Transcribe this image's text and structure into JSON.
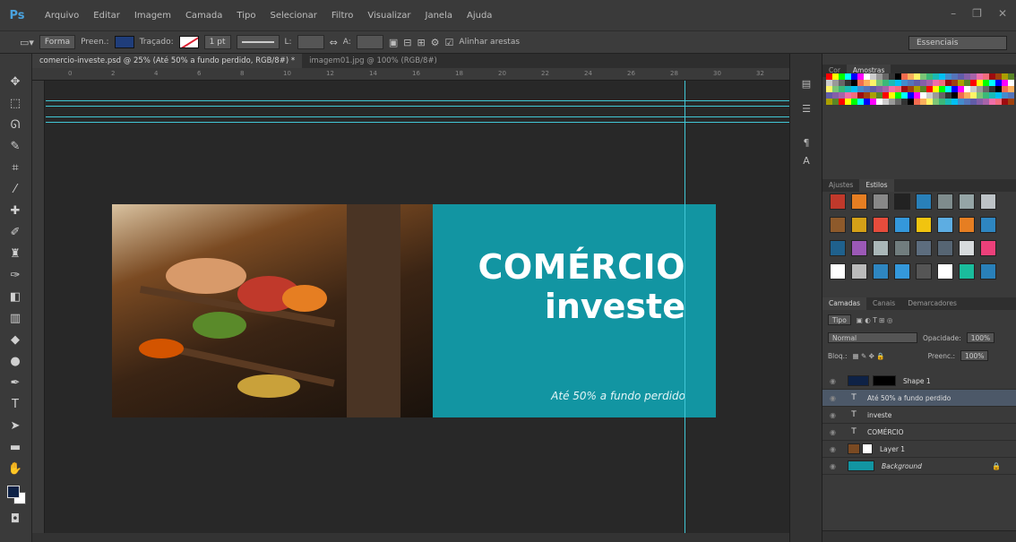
{
  "app": {
    "logo": "Ps"
  },
  "menu": [
    "Arquivo",
    "Editar",
    "Imagem",
    "Camada",
    "Tipo",
    "Selecionar",
    "Filtro",
    "Visualizar",
    "Janela",
    "Ajuda"
  ],
  "window_controls": [
    "–",
    "❐",
    "✕"
  ],
  "options_bar": {
    "mode_label": "Forma",
    "fill_label": "Preen.:",
    "stroke_label": "Traçado:",
    "stroke_width": "1 pt",
    "w_label": "L:",
    "h_label": "A:",
    "align_edges_label": "Alinhar arestas",
    "workspace": "Essenciais"
  },
  "tabs": [
    {
      "label": "comercio-investe.psd @ 25% (Até 50% a fundo perdido, RGB/8#) *",
      "active": true
    },
    {
      "label": "imagem01.jpg @ 100% (RGB/8#)",
      "active": false
    }
  ],
  "ruler_ticks": [
    "0",
    "2",
    "4",
    "6",
    "8",
    "10",
    "12",
    "14",
    "16",
    "18",
    "20",
    "22",
    "24",
    "26",
    "28",
    "30",
    "32"
  ],
  "banner": {
    "title_line1": "COMÉRCIO",
    "title_line2": "investe",
    "tagline": "Até 50% a fundo perdido",
    "teal": "#1295a2"
  },
  "panels": {
    "color_tabs": [
      "Cor",
      "Amostras"
    ],
    "style_tabs": [
      "Ajustes",
      "Estilos"
    ],
    "layer_tabs": [
      "Camadas",
      "Canais",
      "Demarcadores"
    ],
    "kind_label": "Tipo",
    "blend_mode": "Normal",
    "opacity_label": "Opacidade:",
    "opacity_value": "100%",
    "lock_label": "Bloq.:",
    "fill_label": "Preenc.:",
    "fill_value": "100%"
  },
  "layers": [
    {
      "name": "Shape 1",
      "type": "shape",
      "thumb": "#0e2246",
      "selected": false
    },
    {
      "name": "Até 50% a fundo perdido",
      "type": "text",
      "selected": true
    },
    {
      "name": "investe",
      "type": "text",
      "selected": false
    },
    {
      "name": "COMÉRCIO",
      "type": "text",
      "selected": false
    },
    {
      "name": "Layer 1",
      "type": "image",
      "thumb": "#7a4a22",
      "selected": false
    },
    {
      "name": "Background",
      "type": "background",
      "thumb": "#1295a2",
      "selected": false
    }
  ],
  "icons": {
    "tools": [
      "move-icon",
      "marquee-icon",
      "lasso-icon",
      "quick-select-icon",
      "crop-icon",
      "eyedropper-icon",
      "healing-icon",
      "brush-icon",
      "stamp-icon",
      "history-brush-icon",
      "eraser-icon",
      "gradient-icon",
      "blur-icon",
      "dodge-icon",
      "pen-icon",
      "type-icon",
      "path-select-icon",
      "shape-icon",
      "hand-icon",
      "zoom-icon"
    ]
  }
}
